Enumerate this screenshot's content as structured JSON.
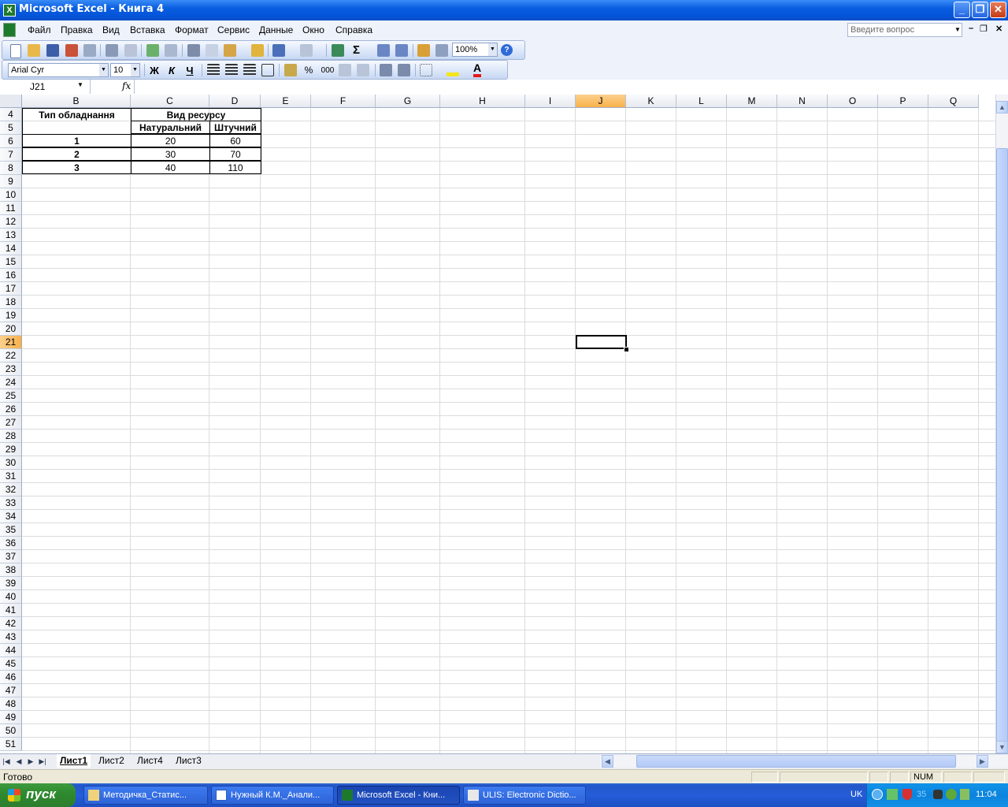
{
  "window": {
    "title": "Microsoft Excel - Книга 4"
  },
  "menu": {
    "items": [
      "Файл",
      "Правка",
      "Вид",
      "Вставка",
      "Формат",
      "Сервис",
      "Данные",
      "Окно",
      "Справка"
    ],
    "help_placeholder": "Введите вопрос"
  },
  "toolbar": {
    "zoom": "100%"
  },
  "format_toolbar": {
    "font": "Arial Cyr",
    "size": "10",
    "bold": "Ж",
    "italic": "К",
    "underline": "Ч",
    "percent": "%",
    "thousands": "000"
  },
  "formula_bar": {
    "name_box": "J21",
    "fx": "fx",
    "content": ""
  },
  "grid": {
    "columns": [
      "B",
      "C",
      "D",
      "E",
      "F",
      "G",
      "H",
      "I",
      "J",
      "K",
      "L",
      "M",
      "N",
      "O",
      "P",
      "Q"
    ],
    "selected_column": "J",
    "first_row": 4,
    "last_row": 51,
    "selected_row": 21
  },
  "table": {
    "header_type": "Тип обладнання",
    "header_resource": "Вид ресурсу",
    "sub_natural": "Натуральний",
    "sub_piece": "Штучний",
    "rows": [
      {
        "type": "1",
        "natural": "20",
        "piece": "60"
      },
      {
        "type": "2",
        "natural": "30",
        "piece": "70"
      },
      {
        "type": "3",
        "natural": "40",
        "piece": "110"
      }
    ]
  },
  "sheets": {
    "tabs": [
      "Лист1",
      "Лист2",
      "Лист4",
      "Лист3"
    ],
    "active": "Лист1"
  },
  "status": {
    "ready": "Готово",
    "num": "NUM"
  },
  "taskbar": {
    "start": "пуск",
    "tasks": [
      "Методичка_Статис...",
      "Нужный К.М._Анали...",
      "Microsoft Excel - Кни...",
      "ULIS: Electronic Dictio..."
    ],
    "active_task": 2,
    "lang": "UK",
    "tray_number": "35",
    "clock": "11:04"
  },
  "colors": {
    "accent": "#0454d9",
    "selected_header": "#f8b14a",
    "grid_line": "#dadcdd"
  }
}
